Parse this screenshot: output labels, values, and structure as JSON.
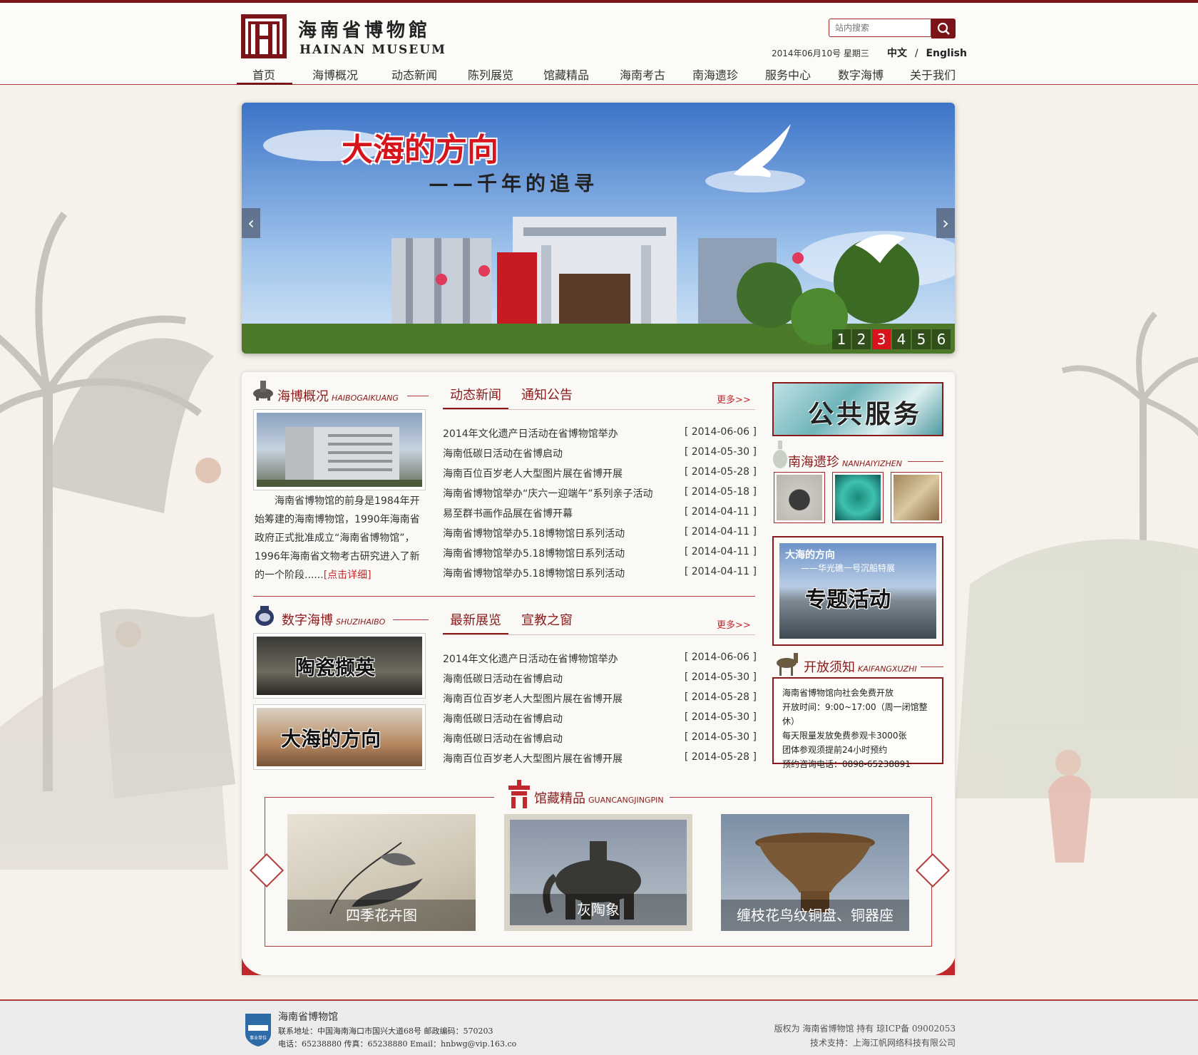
{
  "header": {
    "logo_cn": "海南省博物館",
    "logo_en": "HAINAN MUSEUM",
    "search_placeholder": "站内搜索",
    "date": "2014年06月10号  星期三",
    "lang_zh": "中文",
    "lang_sep": "/",
    "lang_en": "English"
  },
  "nav": [
    "首页",
    "海博概况",
    "动态新闻",
    "陈列展览",
    "馆藏精品",
    "海南考古",
    "南海遗珍",
    "服务中心",
    "数字海博",
    "关于我们"
  ],
  "banner": {
    "title": "大海的方向",
    "subtitle": "——千年的追寻",
    "prev": "‹",
    "next": "›",
    "dots": [
      "1",
      "2",
      "3",
      "4",
      "5",
      "6"
    ],
    "active_dot": 3
  },
  "haibo": {
    "title": "海博概况",
    "title_en": "HAIBOGAIKUANG",
    "intro": "海南省博物馆的前身是1984年开始筹建的海南博物馆，1990年海南省政府正式批准成立“海南省博物馆”，1996年海南省文物考古研究进入了新的一个阶段......",
    "detail_link": "[点击详细]"
  },
  "news_tabs": {
    "tab1": "动态新闻",
    "tab2": "通知公告",
    "more": "更多>>"
  },
  "news": [
    {
      "title": "2014年文化遗产日活动在省博物馆举办",
      "date": "[ 2014-06-06 ]"
    },
    {
      "title": "海南低碳日活动在省博启动",
      "date": "[ 2014-05-30 ]"
    },
    {
      "title": "海南百位百岁老人大型图片展在省博开展",
      "date": "[ 2014-05-28 ]"
    },
    {
      "title": "海南省博物馆举办“庆六一迎端午”系列亲子活动",
      "date": "[ 2014-05-18 ]"
    },
    {
      "title": "易至群书画作品展在省博开幕",
      "date": "[ 2014-04-11 ]"
    },
    {
      "title": "海南省博物馆举办5.18博物馆日系列活动",
      "date": "[ 2014-04-11 ]"
    },
    {
      "title": "海南省博物馆举办5.18博物馆日系列活动",
      "date": "[ 2014-04-11 ]"
    },
    {
      "title": "海南省博物馆举办5.18博物馆日系列活动",
      "date": "[ 2014-04-11 ]"
    }
  ],
  "digital": {
    "title": "数字海博",
    "title_en": "SHUZIHAIBO",
    "img1": "陶瓷撷英",
    "img2": "大海的方向"
  },
  "exhibit_tabs": {
    "tab1": "最新展览",
    "tab2": "宣教之窗",
    "more": "更多>>"
  },
  "exhibits": [
    {
      "title": "2014年文化遗产日活动在省博物馆举办",
      "date": "[ 2014-06-06 ]"
    },
    {
      "title": "海南低碳日活动在省博启动",
      "date": "[ 2014-05-30 ]"
    },
    {
      "title": "海南百位百岁老人大型图片展在省博开展",
      "date": "[ 2014-05-28 ]"
    },
    {
      "title": "海南低碳日活动在省博启动",
      "date": "[ 2014-05-30 ]"
    },
    {
      "title": "海南低碳日活动在省博启动",
      "date": "[ 2014-05-30 ]"
    },
    {
      "title": "海南百位百岁老人大型图片展在省博开展",
      "date": "[ 2014-05-28 ]"
    }
  ],
  "sidebar": {
    "public_service": "公共服务",
    "nanhai_title": "南海遗珍",
    "nanhai_en": "NANHAIYIZHEN",
    "event_line1": "大海的方向",
    "event_line2": "——华光礁一号沉船特展",
    "event_line3": "专题活动",
    "notice_title": "开放须知",
    "notice_en": "KAIFANGXUZHI",
    "notice_lines": [
      "海南省博物馆向社会免费开放",
      "开放时间：9:00~17:00（周一闭馆整休）",
      "每天限量发放免费参观卡3000张",
      "团体参观须提前24小时预约",
      "预约咨询电话：0898-65238891"
    ]
  },
  "collection": {
    "title": "馆藏精品",
    "title_en": "GUANCANGJINGPIN",
    "items": [
      "四季花卉图",
      "灰陶象",
      "缠枝花鸟纹铜盘、铜器座"
    ]
  },
  "footer": {
    "badge": "事业单位",
    "name": "海南省博物馆",
    "address": "联系地址：中国海南海口市国兴大道68号  邮政编码：570203",
    "contact": "电话：65238880  传真：65238880  Email：hnbwg@vip.163.co",
    "copyright": "版权为 海南省博物馆 持有  琼ICP备 09002053",
    "support": "技术支持：上海江帆网络科技有限公司"
  },
  "colors": {
    "brand": "#7a1418",
    "accent": "#d7141c"
  }
}
